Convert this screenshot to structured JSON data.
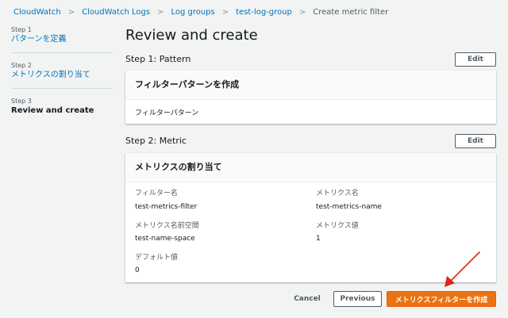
{
  "breadcrumb": {
    "items": [
      "CloudWatch",
      "CloudWatch Logs",
      "Log groups",
      "test-log-group"
    ],
    "current": "Create metric filter"
  },
  "steps": [
    {
      "num": "Step 1",
      "label": "パターンを定義"
    },
    {
      "num": "Step 2",
      "label": "メトリクスの割り当て"
    },
    {
      "num": "Step 3",
      "label": "Review and create"
    }
  ],
  "page_title": "Review and create",
  "section1": {
    "title": "Step 1: Pattern",
    "edit_label": "Edit",
    "card_title": "フィルターパターンを作成",
    "value": "フィルターパターン"
  },
  "section2": {
    "title": "Step 2: Metric",
    "edit_label": "Edit",
    "card_title": "メトリクスの割り当て",
    "fields": {
      "filter_name": {
        "label": "フィルター名",
        "value": "test-metrics-filter"
      },
      "metric_name": {
        "label": "メトリクス名",
        "value": "test-metrics-name"
      },
      "namespace": {
        "label": "メトリクス名前空間",
        "value": "test-name-space"
      },
      "metric_value": {
        "label": "メトリクス値",
        "value": "1"
      },
      "default_value": {
        "label": "デフォルト値",
        "value": "0"
      }
    }
  },
  "footer": {
    "cancel_label": "Cancel",
    "previous_label": "Previous",
    "create_label": "メトリクスフィルターを作成"
  },
  "colors": {
    "link": "#0073bb",
    "primary_button": "#ec7211",
    "annotation_arrow": "#e0251b"
  }
}
